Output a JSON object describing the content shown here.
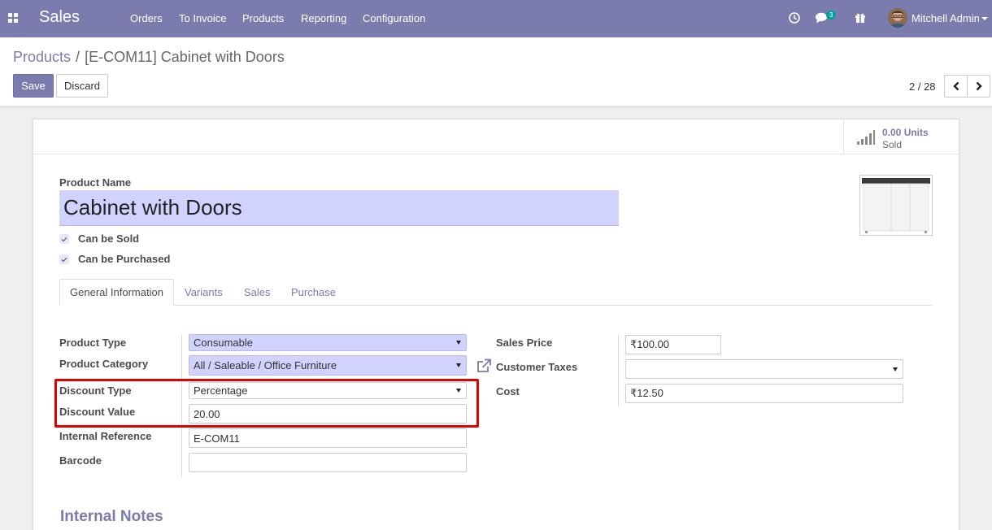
{
  "navbar": {
    "app_name": "Sales",
    "menu": [
      "Orders",
      "To Invoice",
      "Products",
      "Reporting",
      "Configuration"
    ],
    "messages_count": "3",
    "user_name": "Mitchell Admin",
    "icons": [
      "apps-icon",
      "clock-icon",
      "chat-icon",
      "gift-icon",
      "avatar",
      "caret-down-icon"
    ]
  },
  "breadcrumb": {
    "parent": "Products",
    "separator": "/",
    "current": "[E-COM11] Cabinet with Doors"
  },
  "actions": {
    "save": "Save",
    "discard": "Discard"
  },
  "pager": {
    "value": "2 / 28"
  },
  "stat_button": {
    "value": "0.00 Units",
    "label": "Sold"
  },
  "form": {
    "product_name_label": "Product Name",
    "product_name": "Cabinet with Doors",
    "can_be_sold_label": "Can be Sold",
    "can_be_purchased_label": "Can be Purchased",
    "can_be_sold": true,
    "can_be_purchased": true
  },
  "tabs": [
    "General Information",
    "Variants",
    "Sales",
    "Purchase"
  ],
  "fields": {
    "product_type": {
      "label": "Product Type",
      "value": "Consumable"
    },
    "product_category": {
      "label": "Product Category",
      "value": "All / Saleable / Office Furniture"
    },
    "discount_type": {
      "label": "Discount Type",
      "value": "Percentage"
    },
    "discount_value": {
      "label": "Discount Value",
      "value": "20.00"
    },
    "internal_reference": {
      "label": "Internal Reference",
      "value": "E-COM11"
    },
    "barcode": {
      "label": "Barcode",
      "value": ""
    },
    "sales_price": {
      "label": "Sales Price",
      "value": "₹100.00"
    },
    "customer_taxes": {
      "label": "Customer Taxes",
      "value": ""
    },
    "cost": {
      "label": "Cost",
      "value": "₹12.50"
    }
  },
  "internal_notes_title": "Internal Notes",
  "colors": {
    "brand": "#7c7bad",
    "required_field": "#d2d2ff",
    "highlight": "#e00000"
  }
}
